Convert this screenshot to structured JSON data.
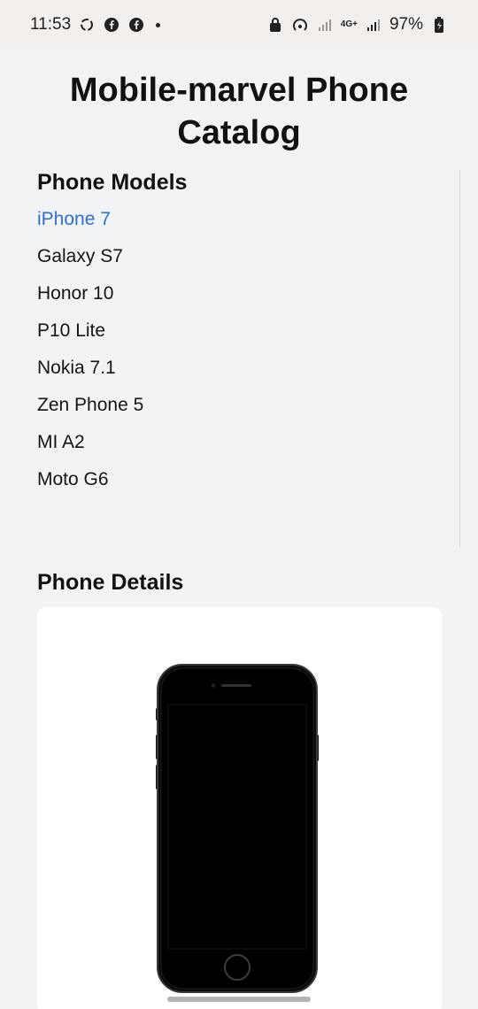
{
  "status_bar": {
    "time": "11:53",
    "battery": "97%",
    "network": "4G+"
  },
  "header": {
    "title": "Mobile-marvel Phone Catalog"
  },
  "models": {
    "heading": "Phone Models",
    "items": [
      {
        "label": "iPhone 7",
        "active": true
      },
      {
        "label": "Galaxy S7",
        "active": false
      },
      {
        "label": "Honor 10",
        "active": false
      },
      {
        "label": "P10 Lite",
        "active": false
      },
      {
        "label": "Nokia 7.1",
        "active": false
      },
      {
        "label": "Zen Phone 5",
        "active": false
      },
      {
        "label": "MI A2",
        "active": false
      },
      {
        "label": "Moto G6",
        "active": false
      }
    ]
  },
  "details": {
    "heading": "Phone Details",
    "image": "iphone-7-image"
  },
  "colors": {
    "accent_link": "#2f6fd0",
    "background": "#f2f3f5",
    "card": "#ffffff"
  }
}
